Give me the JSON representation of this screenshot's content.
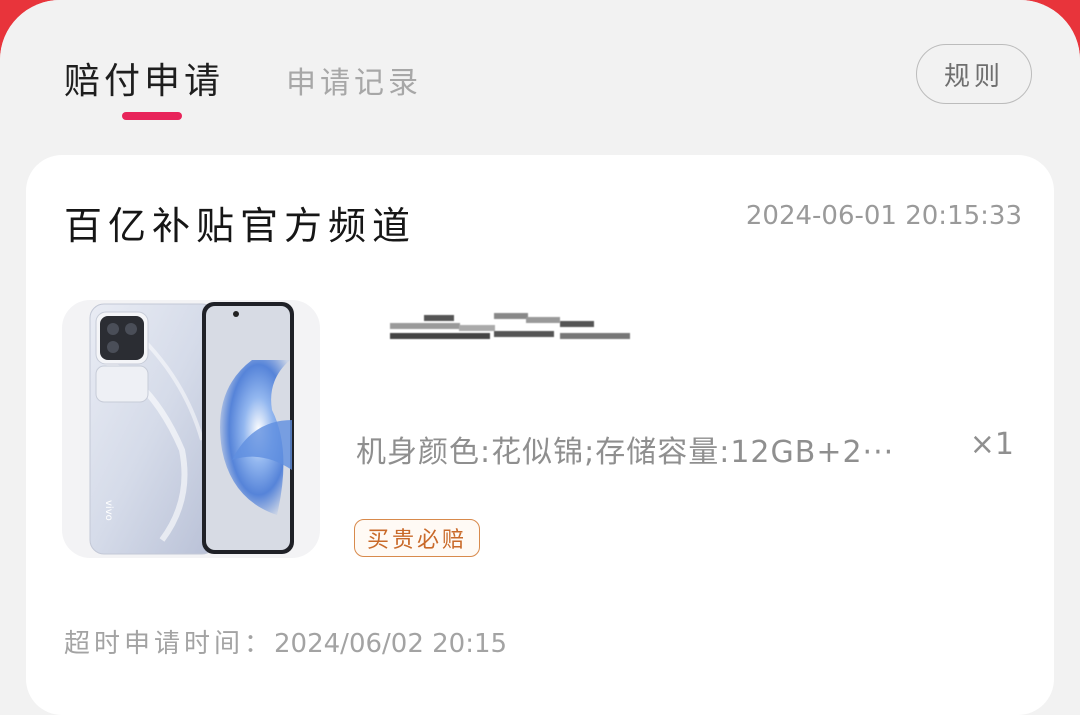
{
  "tabs": [
    {
      "label": "赔付申请",
      "active": true
    },
    {
      "label": "申请记录",
      "active": false
    }
  ],
  "rules_button": "规则",
  "accent_color": "#e8245a",
  "card": {
    "shop_name": "百亿补贴官方频道",
    "order_time": "2024-06-01 20:15:33",
    "product": {
      "image_icon": "phone-product-image",
      "spec": "机身颜色:花似锦;存储容量:12GB+2···",
      "quantity": "×1",
      "badge": "买贵必赔"
    },
    "deadline_label": "超时申请时间：",
    "deadline_value": "2024/06/02 20:15"
  }
}
